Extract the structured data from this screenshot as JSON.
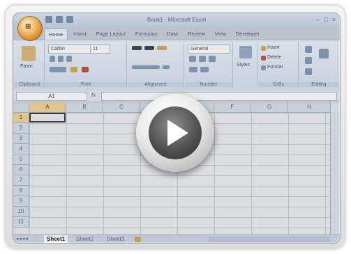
{
  "window": {
    "title": "Book1 - Microsoft Excel",
    "office_button_label": "⊞",
    "controls": [
      "–",
      "□",
      "×"
    ]
  },
  "tabs": [
    "Home",
    "Insert",
    "Page Layout",
    "Formulas",
    "Data",
    "Review",
    "View",
    "Developer"
  ],
  "ribbon": {
    "font_name": "Calibri",
    "font_size": "11",
    "number_format": "General",
    "paste_label": "Paste",
    "styles_label": "Styles",
    "insert_label": "Insert",
    "delete_label": "Delete",
    "format_label": "Format",
    "groups": [
      "Clipboard",
      "Font",
      "Alignment",
      "Number",
      "Cells",
      "Editing"
    ]
  },
  "formula_bar": {
    "name_box": "A1",
    "fx": "fx"
  },
  "grid": {
    "columns": [
      "A",
      "B",
      "C",
      "D",
      "E",
      "F",
      "G",
      "H"
    ],
    "rows": [
      "1",
      "2",
      "3",
      "4",
      "5",
      "6",
      "7",
      "8",
      "9",
      "10",
      "11"
    ],
    "selected_column": "A",
    "selected_row": "1"
  },
  "sheets": [
    "Sheet1",
    "Sheet2",
    "Sheet3"
  ],
  "active_sheet": "Sheet1",
  "overlay": {
    "icon": "play-icon"
  }
}
